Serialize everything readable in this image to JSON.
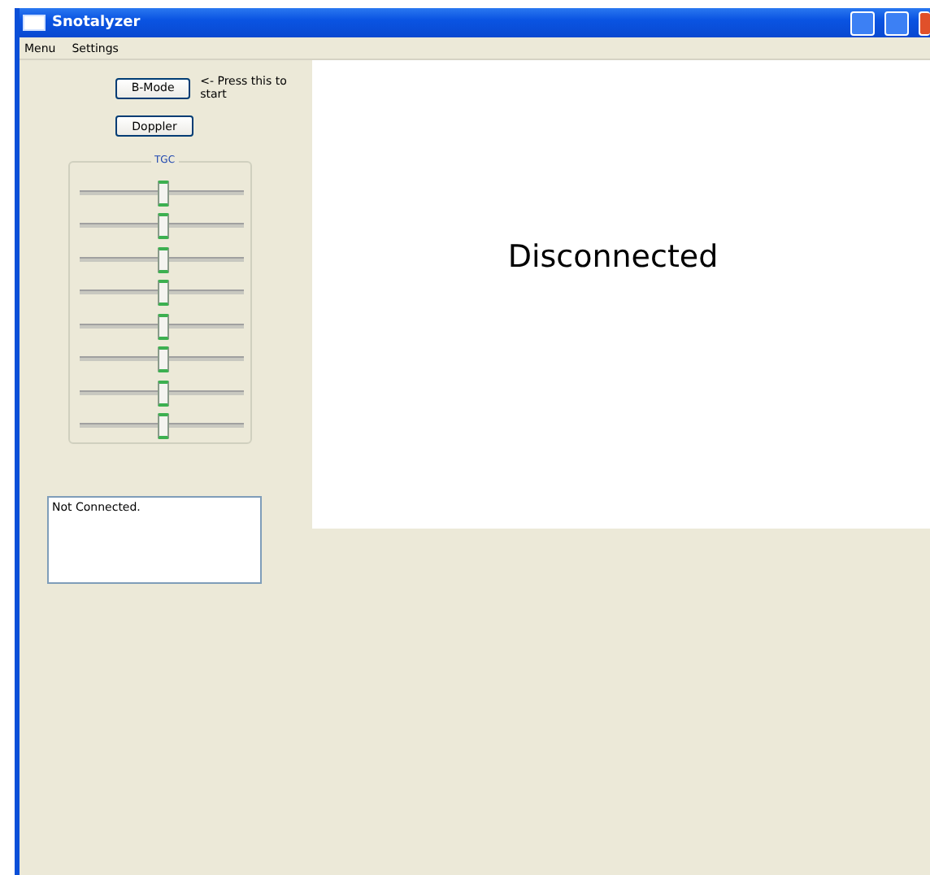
{
  "window": {
    "title": "Snotalyzer"
  },
  "menu": [
    "Menu",
    "Settings"
  ],
  "buttons": [
    {
      "label": "B-Mode",
      "hint": "<- Press this to start"
    },
    {
      "label": "Doppler"
    }
  ],
  "tgc": {
    "title": "TGC",
    "sliders": [
      {
        "level": 0.5
      },
      {
        "level": 0.5
      },
      {
        "level": 0.5
      },
      {
        "level": 0.5
      },
      {
        "level": 0.5
      },
      {
        "level": 0.5
      },
      {
        "level": 0.5
      },
      {
        "level": 0.5
      }
    ]
  },
  "log": {
    "value": "Not Connected."
  },
  "display": {
    "message": "Disconnected"
  }
}
